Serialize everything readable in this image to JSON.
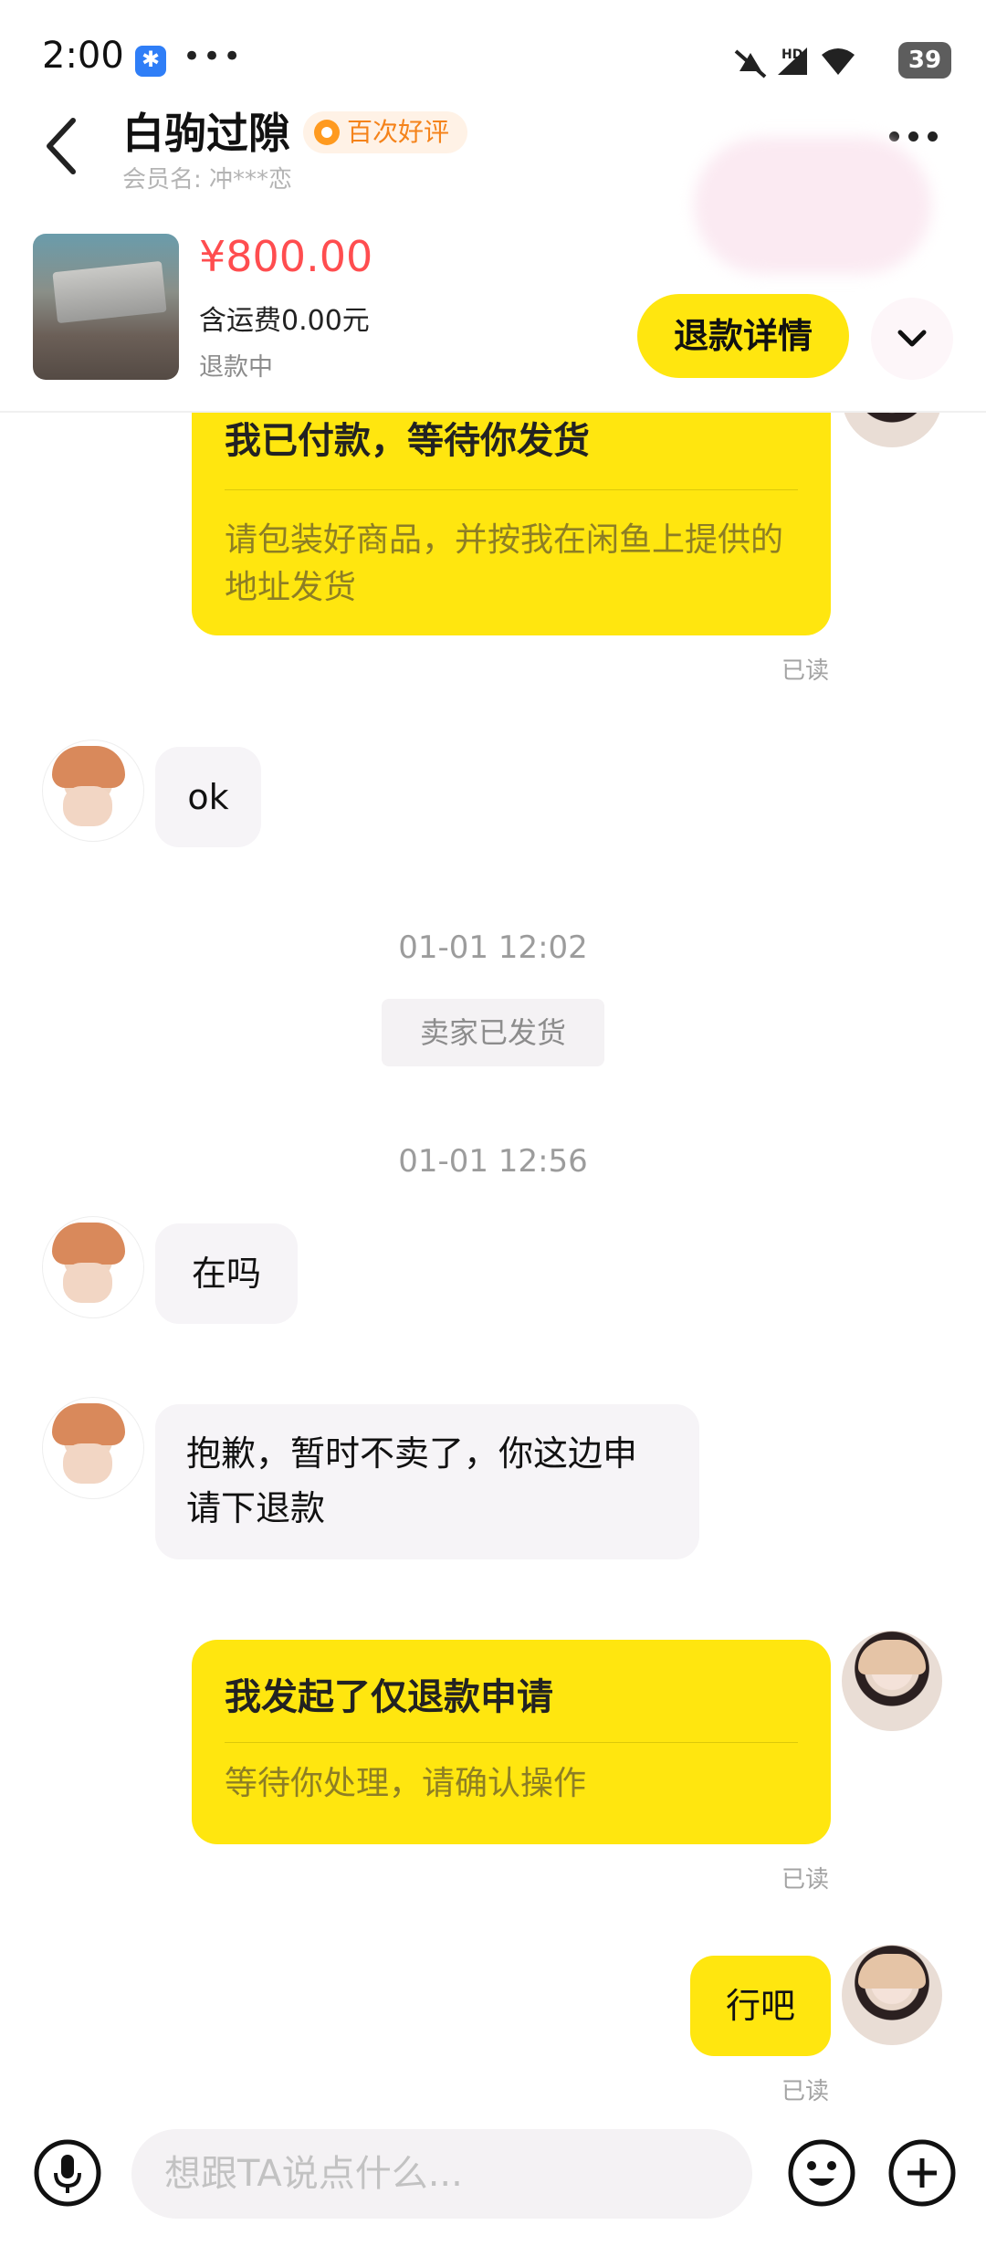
{
  "status_bar": {
    "time": "2:00",
    "dots": "•••",
    "battery": "39"
  },
  "header": {
    "title": "白驹过隙",
    "badge": "百次好评",
    "member": "会员名: 冲***恋"
  },
  "product": {
    "price": "¥800.00",
    "shipping": "含运费0.00元",
    "status": "退款中",
    "refund_button": "退款详情"
  },
  "messages": {
    "card1_title": "我已付款，等待你发货",
    "card1_body": "请包装好商品，并按我在闲鱼上提供的地址发货",
    "read": "已读",
    "msg_ok": "ok",
    "time1": "01-01 12:02",
    "system1": "卖家已发货",
    "time2": "01-01 12:56",
    "msg_zaima": "在吗",
    "msg_sorry": "抱歉，暂时不卖了，你这边申请下退款",
    "card2_title": "我发起了仅退款申请",
    "card2_body": "等待你处理，请确认操作",
    "msg_xingba": "行吧"
  },
  "input": {
    "placeholder": "想跟TA说点什么..."
  }
}
